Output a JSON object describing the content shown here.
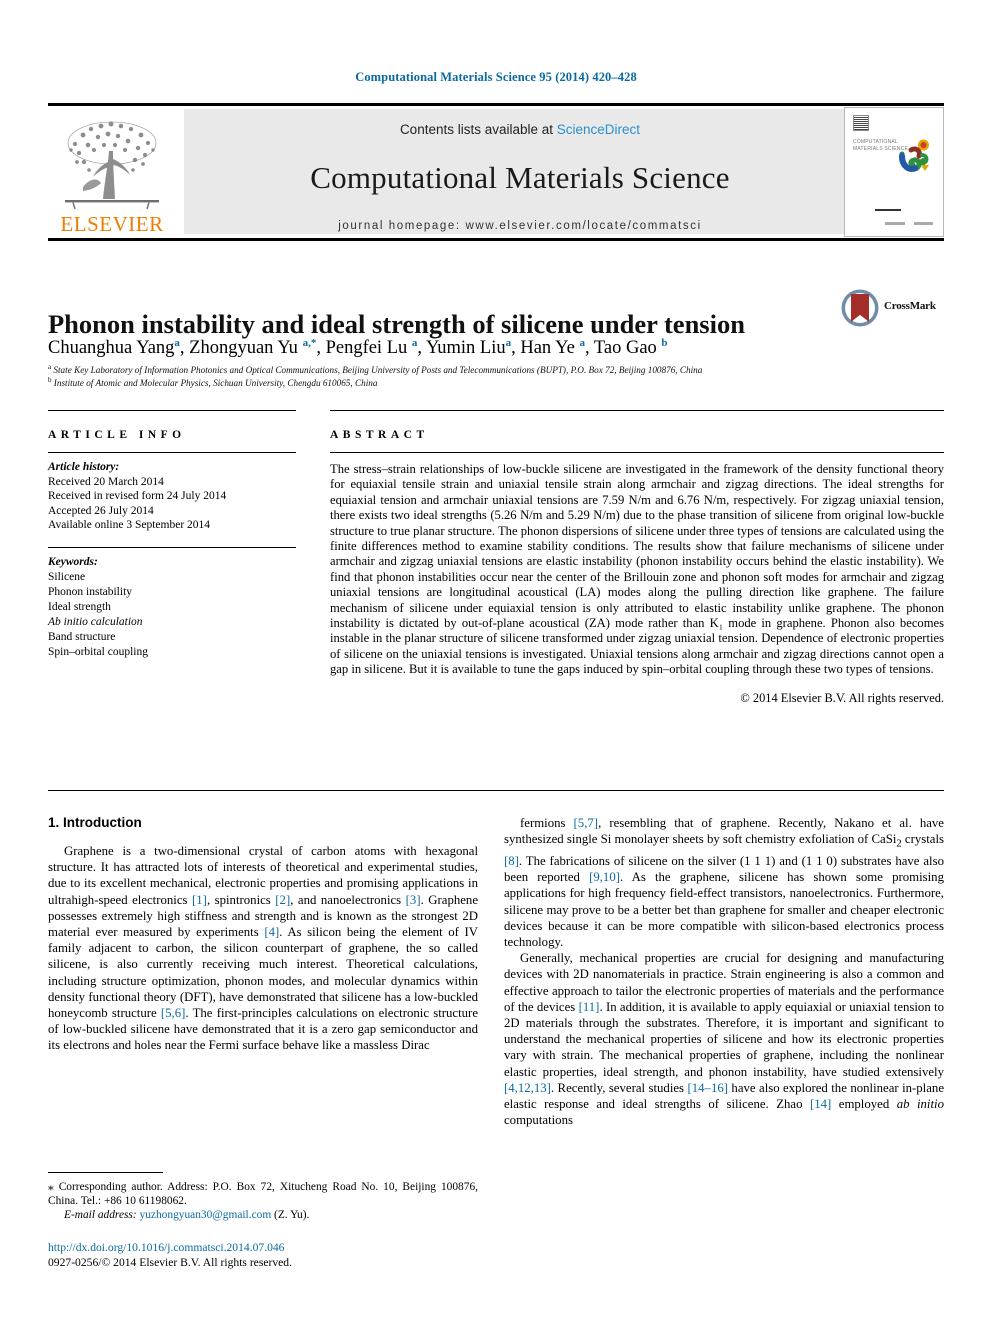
{
  "running_head": "Computational Materials Science 95 (2014) 420–428",
  "masthead": {
    "contents_prefix": "Contents lists available at ",
    "sciencedirect": "ScienceDirect",
    "journal_name": "Computational Materials Science",
    "homepage": "journal homepage: www.elsevier.com/locate/commatsci",
    "publisher": "ELSEVIER",
    "cover_title": "COMPUTATIONAL MATERIALS SCIENCE"
  },
  "article": {
    "title": "Phonon instability and ideal strength of silicene under tension",
    "authors_html": "Chuanghua Yang<sup>a</sup>, Zhongyuan Yu <sup>a,*</sup>, Pengfei Lu <sup>a</sup>, Yumin Liu<sup>a</sup>, Han Ye <sup>a</sup>, Tao Gao <sup>b</sup>",
    "affiliation_a": "State Key Laboratory of Information Photonics and Optical Communications, Beijing University of Posts and Telecommunications (BUPT), P.O. Box 72, Beijing 100876, China",
    "affiliation_b": "Institute of Atomic and Molecular Physics, Sichuan University, Chengdu 610065, China",
    "crossmark_label": "CrossMark"
  },
  "article_info": {
    "heading": "ARTICLE INFO",
    "history_label": "Article history:",
    "history": [
      "Received 20 March 2014",
      "Received in revised form 24 July 2014",
      "Accepted 26 July 2014",
      "Available online 3 September 2014"
    ],
    "keywords_label": "Keywords:",
    "keywords": [
      "Silicene",
      "Phonon instability",
      "Ideal strength",
      "Ab initio calculation",
      "Band structure",
      "Spin–orbital coupling"
    ]
  },
  "abstract": {
    "heading": "ABSTRACT",
    "text": "The stress–strain relationships of low-buckle silicene are investigated in the framework of the density functional theory for equiaxial tensile strain and uniaxial tensile strain along armchair and zigzag directions. The ideal strengths for equiaxial tension and armchair uniaxial tensions are 7.59 N/m and 6.76 N/m, respectively. For zigzag uniaxial tension, there exists two ideal strengths (5.26 N/m and 5.29 N/m) due to the phase transition of silicene from original low-buckle structure to true planar structure. The phonon dispersions of silicene under three types of tensions are calculated using the finite differences method to examine stability conditions. The results show that failure mechanisms of silicene under armchair and zigzag uniaxial tensions are elastic instability (phonon instability occurs behind the elastic instability). We find that phonon instabilities occur near the center of the Brillouin zone and phonon soft modes for armchair and zigzag uniaxial tensions are longitudinal acoustical (LA) modes along the pulling direction like graphene. The failure mechanism of silicene under equiaxial tension is only attributed to elastic instability unlike graphene. The phonon instability is dictated by out-of-plane acoustical (ZA) mode rather than K₁ mode in graphene. Phonon also becomes instable in the planar structure of silicene transformed under zigzag uniaxial tension. Dependence of electronic properties of silicene on the uniaxial tensions is investigated. Uniaxial tensions along armchair and zigzag directions cannot open a gap in silicene. But it is available to tune the gaps induced by spin–orbital coupling through these two types of tensions.",
    "copyright": "© 2014 Elsevier B.V. All rights reserved."
  },
  "introduction": {
    "heading": "1. Introduction",
    "left_para_1_html": "Graphene is a two-dimensional crystal of carbon atoms with hexagonal structure. It has attracted lots of interests of theoretical and experimental studies, due to its excellent mechanical, electronic properties and promising applications in ultrahigh-speed electronics <span class=\"ref\">[1]</span>, spintronics <span class=\"ref\">[2]</span>, and nanoelectronics <span class=\"ref\">[3]</span>. Graphene possesses extremely high stiffness and strength and is known as the strongest 2D material ever measured by experiments <span class=\"ref\">[4]</span>. As silicon being the element of IV family adjacent to carbon, the silicon counterpart of graphene, the so called silicene, is also currently receiving much interest. Theoretical calculations, including structure optimization, phonon modes, and molecular dynamics within density functional theory (DFT), have demonstrated that silicene has a low-buckled honeycomb structure <span class=\"ref\">[5,6]</span>. The first-principles calculations on electronic structure of low-buckled silicene have demonstrated that it is a zero gap semiconductor and its electrons and holes near the Fermi surface behave like a massless Dirac",
    "right_para_1_html": "fermions <span class=\"ref\">[5,7]</span>, resembling that of graphene. Recently, Nakano et al. have synthesized single Si monolayer sheets by soft chemistry exfoliation of CaSi<sub>2</sub> crystals <span class=\"ref\">[8]</span>. The fabrications of silicene on the silver (1 1 1) and (1 1 0) substrates have also been reported <span class=\"ref\">[9,10]</span>. As the graphene, silicene has shown some promising applications for high frequency field-effect transistors, nanoelectronics. Furthermore, silicene may prove to be a better bet than graphene for smaller and cheaper electronic devices because it can be more compatible with silicon-based electronics process technology.",
    "right_para_2_html": "Generally, mechanical properties are crucial for designing and manufacturing devices with 2D nanomaterials in practice. Strain engineering is also a common and effective approach to tailor the electronic properties of materials and the performance of the devices <span class=\"ref\">[11]</span>. In addition, it is available to apply equiaxial or uniaxial tension to 2D materials through the substrates. Therefore, it is important and significant to understand the mechanical properties of silicene and how its electronic properties vary with strain. The mechanical properties of graphene, including the nonlinear elastic properties, ideal strength, and phonon instability, have studied extensively <span class=\"ref\">[4,12,13]</span>. Recently, several studies <span class=\"ref\">[14–16]</span> have also explored the nonlinear in-plane elastic response and ideal strengths of silicene. Zhao <span class=\"ref\">[14]</span> employed <em>ab initio</em> computations"
  },
  "footnote": {
    "corresponding_html": "<span class=\"star\">⁎</span> Corresponding author. Address: P.O. Box 72, Xitucheng Road No. 10, Beijing 100876, China. Tel.: +86 10 61198062.",
    "email_label": "E-mail address:",
    "email": "yuzhongyuan30@gmail.com",
    "email_owner": "(Z. Yu)."
  },
  "doi": {
    "url": "http://dx.doi.org/10.1016/j.commatsci.2014.07.046",
    "issn_line": "0927-0256/© 2014 Elsevier B.V. All rights reserved."
  },
  "colors": {
    "link": "#0a6aa1",
    "elsevier_orange": "#f07d00",
    "sciencedirect": "#2b8fc9",
    "crossmark_red": "#a42f2a",
    "crossmark_blue": "#6f8da8"
  }
}
